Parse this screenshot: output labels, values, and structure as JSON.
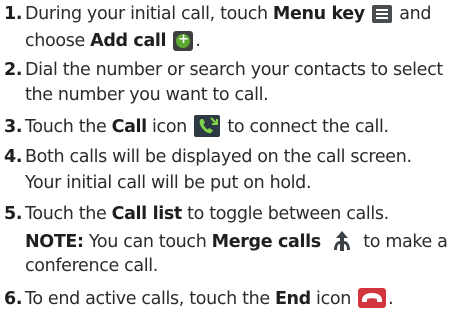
{
  "steps": [
    {
      "number": "1.",
      "line1": {
        "pre": "During your initial call, touch ",
        "bold": "Menu key",
        "post": " and"
      },
      "line2": {
        "pre": "choose ",
        "bold": "Add call",
        "post": "."
      },
      "icons": [
        "menu-icon",
        "add-call-icon"
      ]
    },
    {
      "number": "2.",
      "line1": "Dial the number or search your contacts to select",
      "line2": "the number you want to call."
    },
    {
      "number": "3.",
      "line1": {
        "pre": "Touch the ",
        "bold": "Call",
        "post_before_icon": " icon",
        "post": " to connect the call."
      },
      "icons": [
        "call-icon"
      ]
    },
    {
      "number": "4.",
      "line1": "Both calls will be displayed on the call screen.",
      "line2": "Your initial call will be put on hold."
    },
    {
      "number": "5.",
      "line1": {
        "pre": "Touch the ",
        "bold": "Call list",
        "post": " to toggle between calls."
      },
      "note": {
        "label": "NOTE:",
        "pre": " You can touch ",
        "bold": "Merge calls",
        "post": " to make a"
      },
      "line3": "conference call.",
      "icons": [
        "merge-calls-icon"
      ]
    },
    {
      "number": "6.",
      "line1": {
        "pre": "To end active calls, touch the ",
        "bold": "End",
        "post_before_icon": " icon",
        "post": "."
      },
      "icons": [
        "end-call-icon"
      ]
    }
  ],
  "colors": {
    "text": "#2b2b2b",
    "add_icon_green": "#5ea832",
    "call_icon_green": "#7fd04a",
    "end_icon_red": "#d3353f",
    "merge_icon_dark": "#3b4247"
  }
}
